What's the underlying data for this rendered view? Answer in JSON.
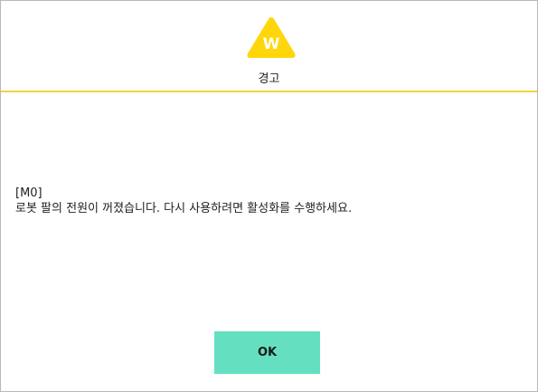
{
  "dialog": {
    "icon": "warning-triangle-icon",
    "icon_letter": "W",
    "title": "경고",
    "message_code": "[M0]",
    "message_text": "로봇 팔의 전원이 꺼졌습니다. 다시 사용하려면 활성화를 수행하세요.",
    "ok_label": "OK"
  },
  "colors": {
    "icon_fill": "#ffd60a",
    "header_rule": "#f2d43a",
    "ok_button": "#64e0c0"
  }
}
